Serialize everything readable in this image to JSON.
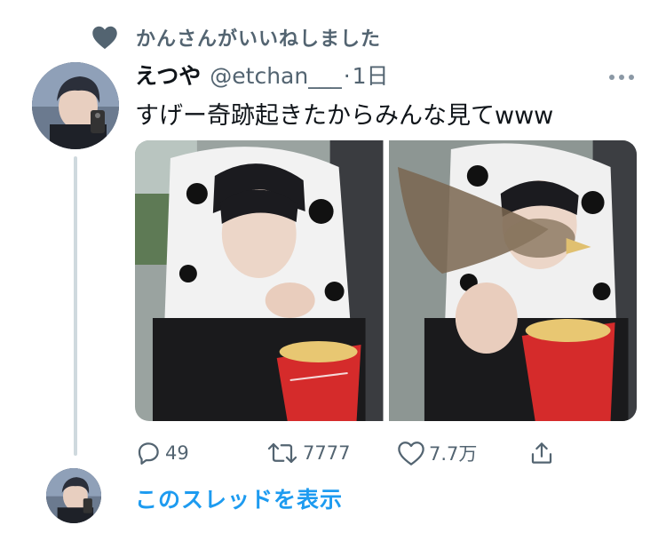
{
  "social_context": {
    "text": "かんさんがいいねしました",
    "icon": "heart-icon"
  },
  "tweet": {
    "display_name": "えつや",
    "handle": "@etchan___",
    "separator": "·",
    "time": "1日",
    "more_icon": "more-icon",
    "text": "すげー奇跡起きたからみんな見てwww",
    "media": [
      {
        "description_icon": "photo-person-popcorn"
      },
      {
        "description_icon": "photo-bird-flying"
      }
    ],
    "actions": {
      "reply": {
        "icon": "reply-icon",
        "count": "49"
      },
      "retweet": {
        "icon": "retweet-icon",
        "count": "7777"
      },
      "like": {
        "icon": "like-icon",
        "count": "7.7万"
      },
      "share": {
        "icon": "share-icon"
      }
    }
  },
  "thread": {
    "show_label": "このスレッドを表示"
  },
  "colors": {
    "accent": "#1d9bf0",
    "secondary_text": "#536471",
    "line": "#cfd9de"
  }
}
